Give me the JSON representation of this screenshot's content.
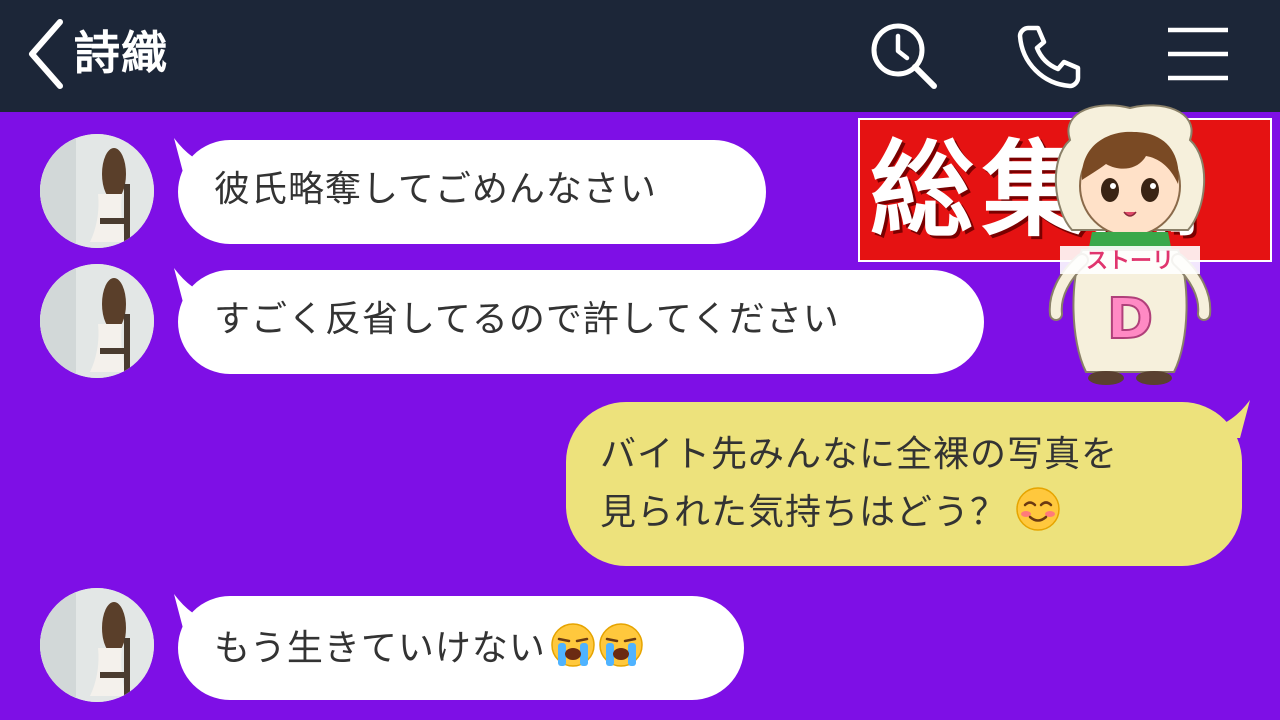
{
  "header": {
    "title": "詩織"
  },
  "messages": [
    {
      "side": "in",
      "text": "彼氏略奪してごめんなさい"
    },
    {
      "side": "in",
      "text": "すごく反省してるので許してください"
    },
    {
      "side": "out",
      "line1": "バイト先みんなに全裸の写真を",
      "line2": "見られた気持ちはどう？",
      "emoji": "smiling-blush-emoji"
    },
    {
      "side": "in",
      "text": "もう生きていけない",
      "emoji": "loudly-crying-emoji"
    }
  ],
  "overlay": {
    "stamp_text": "総集編",
    "mascot_sign": "ストーリ",
    "mascot_letter": "D"
  },
  "colors": {
    "background": "#7e0fe6",
    "header": "#1c2638",
    "incoming_bubble": "#ffffff",
    "outgoing_bubble": "#ede27c",
    "stamp": "#e51212"
  }
}
